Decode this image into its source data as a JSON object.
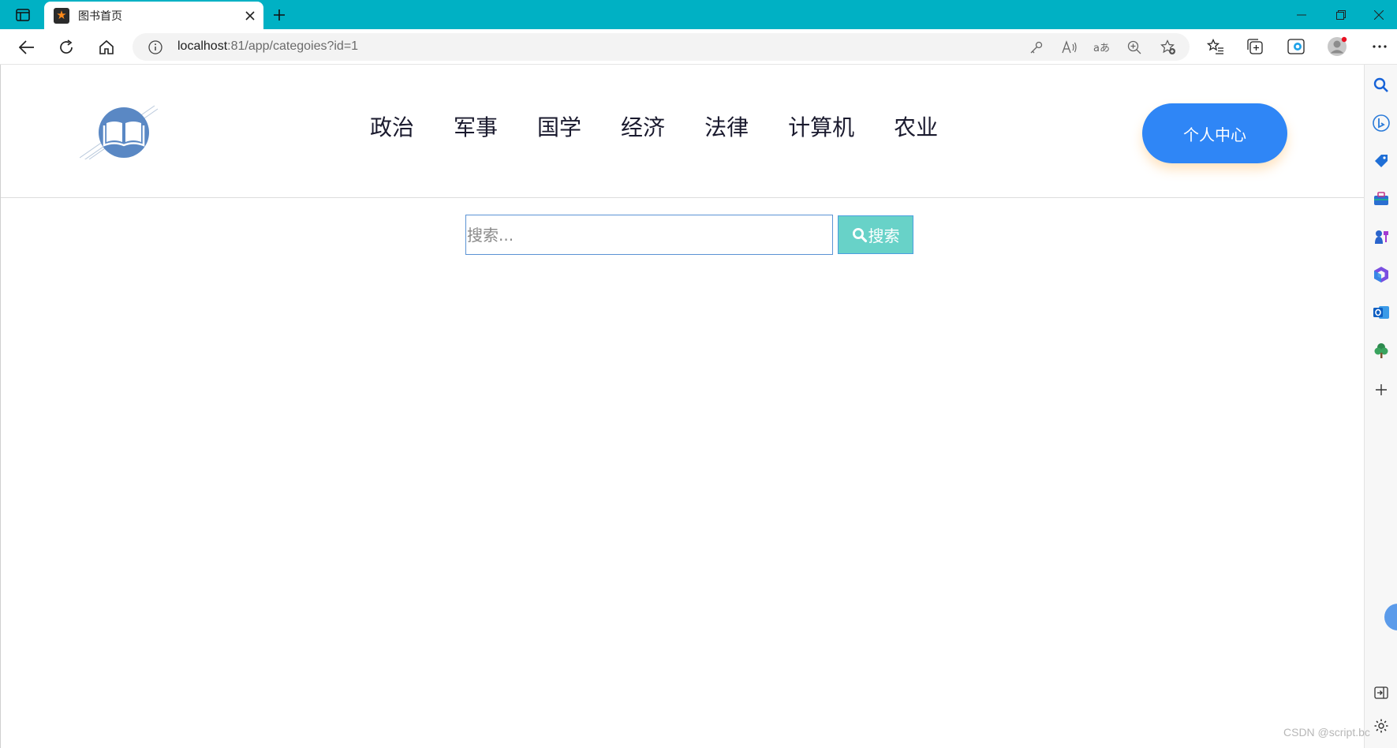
{
  "browser": {
    "tab_title": "图书首页",
    "url_host": "localhost",
    "url_rest": ":81/app/categoies?id=1"
  },
  "site": {
    "nav": [
      "政治",
      "军事",
      "国学",
      "经济",
      "法律",
      "计算机",
      "农业"
    ],
    "profile_button": "个人中心",
    "search": {
      "placeholder": "搜索...",
      "button_label": "搜索"
    }
  },
  "watermark": "CSDN @script.bc",
  "colors": {
    "titlebar": "#00b1c4",
    "profile_button": "#2f86f6",
    "search_button": "#68d2c8",
    "logo": "#5a88c4"
  }
}
